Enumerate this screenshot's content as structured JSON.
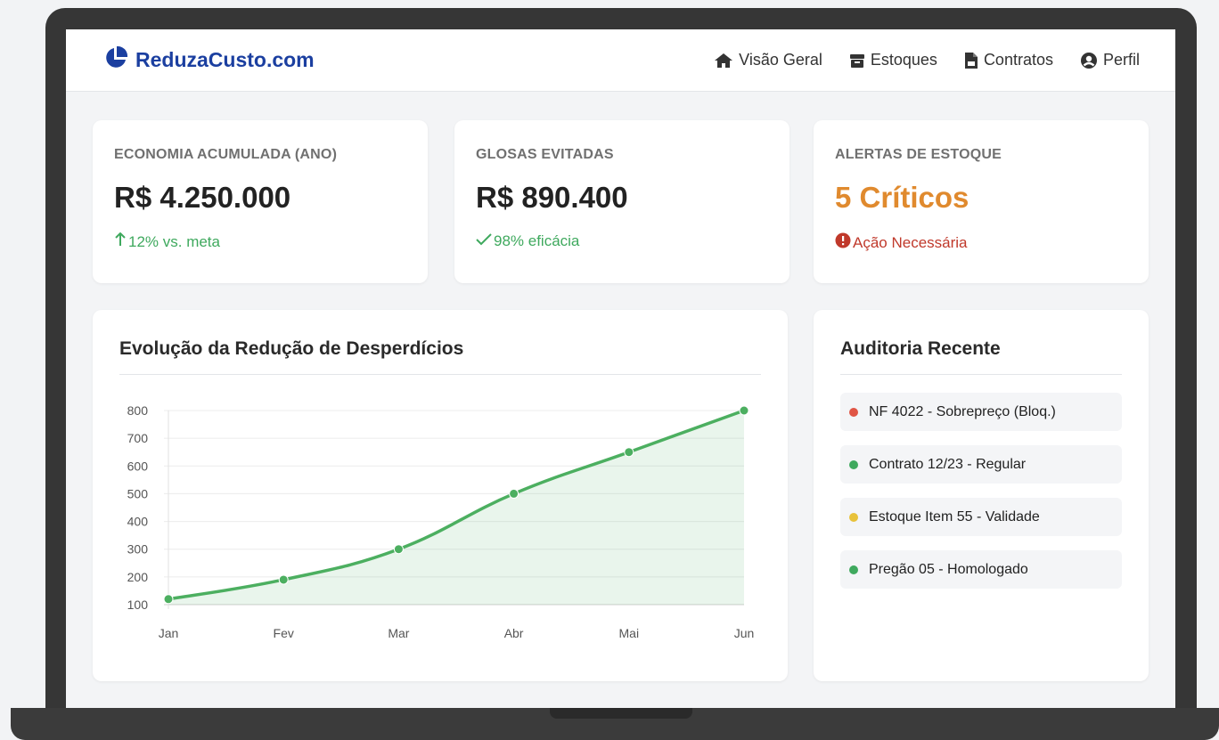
{
  "brand": {
    "name": "ReduzaCusto.com",
    "icon": "pie-chart-icon",
    "color": "#1b3fa0"
  },
  "nav": [
    {
      "label": "Visão Geral",
      "icon": "home-icon"
    },
    {
      "label": "Estoques",
      "icon": "box-icon"
    },
    {
      "label": "Contratos",
      "icon": "file-pdf-icon"
    },
    {
      "label": "Perfil",
      "icon": "user-circle-icon"
    }
  ],
  "kpis": [
    {
      "title": "ECONOMIA ACUMULADA (ANO)",
      "value": "R$ 4.250.000",
      "sub": "12% vs. meta",
      "sub_icon": "arrow-up-icon"
    },
    {
      "title": "GLOSAS EVITADAS",
      "value": "R$ 890.400",
      "sub": "98% eficácia",
      "sub_icon": "check-icon"
    },
    {
      "title": "ALERTAS DE ESTOQUE",
      "value": "5 Críticos",
      "sub": "Ação Necessária",
      "sub_icon": "exclamation-circle-icon"
    }
  ],
  "chart_title": "Evolução da Redução de Desperdícios",
  "chart_data": {
    "type": "line",
    "categories": [
      "Jan",
      "Fev",
      "Mar",
      "Abr",
      "Mai",
      "Jun"
    ],
    "series": [
      {
        "values": [
          120,
          190,
          300,
          500,
          650,
          800
        ],
        "color": "#4caf60"
      }
    ],
    "y_ticks": [
      100,
      200,
      300,
      400,
      500,
      600,
      700,
      800
    ],
    "ylim": [
      100,
      800
    ],
    "grid": true,
    "fill": true
  },
  "audit": {
    "title": "Auditoria Recente",
    "items": [
      {
        "label": "NF 4022 - Sobrepreço (Bloq.)",
        "color": "#e05545"
      },
      {
        "label": "Contrato 12/23 - Regular",
        "color": "#3fa95e"
      },
      {
        "label": "Estoque Item 55 - Validade",
        "color": "#e8c23a"
      },
      {
        "label": "Pregão 05 - Homologado",
        "color": "#3fa95e"
      }
    ]
  }
}
